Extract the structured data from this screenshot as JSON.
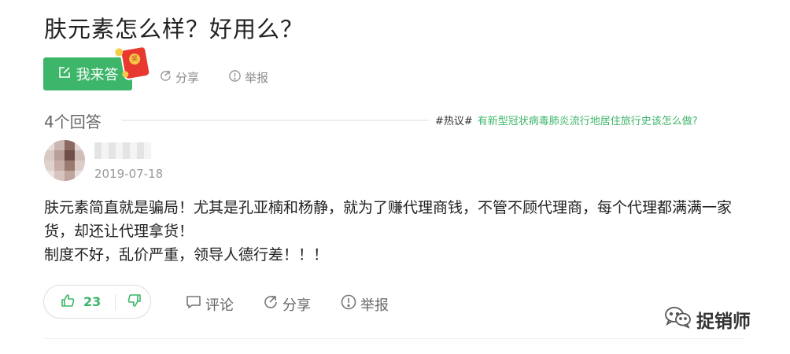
{
  "question": {
    "title": "肤元素怎么样？好用么？"
  },
  "toolbar": {
    "answer_label": "我来答",
    "share_label": "分享",
    "report_label": "举报",
    "redpacket_glyph": "奖"
  },
  "answers_header": {
    "count_label": "4个回答",
    "hot_tag": "#热议#",
    "hot_link": "有新型冠状病毒肺炎流行地居住旅行史该怎么做?"
  },
  "answer": {
    "date": "2019-07-18",
    "paragraphs": [
      "肤元素简直就是骗局！尤其是孔亚楠和杨静，就为了赚代理商钱，不管不顾代理商，每个代理都满满一家货，却还让代理拿货！",
      "制度不好，乱价严重，领导人德行差！！！"
    ],
    "likes": "23",
    "comment_label": "评论",
    "share_label": "分享",
    "report_label": "举报"
  },
  "watermark": {
    "text": "捉销师"
  },
  "colors": {
    "accent": "#3eb66a",
    "redpacket": "#e8382f",
    "text_muted": "#999999"
  }
}
